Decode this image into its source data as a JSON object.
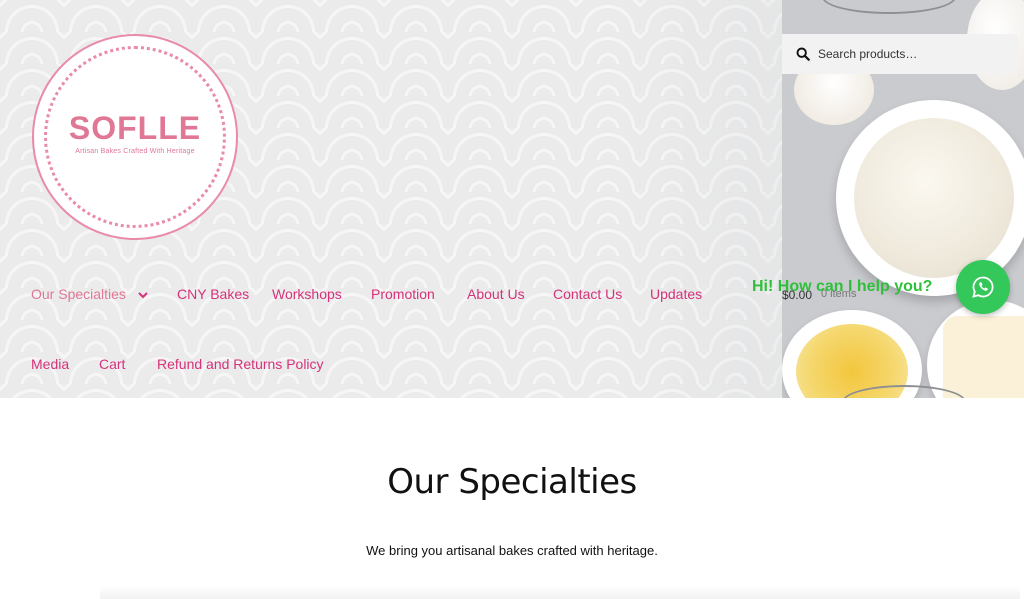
{
  "brand": {
    "name": "SOFLLE",
    "tagline": "Artisan Bakes Crafted With Heritage"
  },
  "search": {
    "placeholder": "Search products…"
  },
  "nav": {
    "items": [
      {
        "label": "Our Specialties",
        "active": true,
        "has_dropdown": true
      },
      {
        "label": "CNY Bakes"
      },
      {
        "label": "Workshops"
      },
      {
        "label": "Promotion"
      },
      {
        "label": "About Us"
      },
      {
        "label": "Contact Us"
      },
      {
        "label": "Updates"
      },
      {
        "label": "Media"
      },
      {
        "label": "Cart"
      },
      {
        "label": "Refund and Returns Policy"
      }
    ]
  },
  "cart": {
    "total": "$0.00",
    "count": "0 items"
  },
  "chat": {
    "greeting": "Hi! How can I help you?",
    "icon": "whatsapp-icon"
  },
  "main": {
    "title": "Our Specialties",
    "subtitle": "We bring you artisanal bakes crafted with heritage."
  },
  "colors": {
    "nav_link": "#d6317a",
    "brand_pink": "#e07795",
    "chat_green": "#34c759"
  }
}
